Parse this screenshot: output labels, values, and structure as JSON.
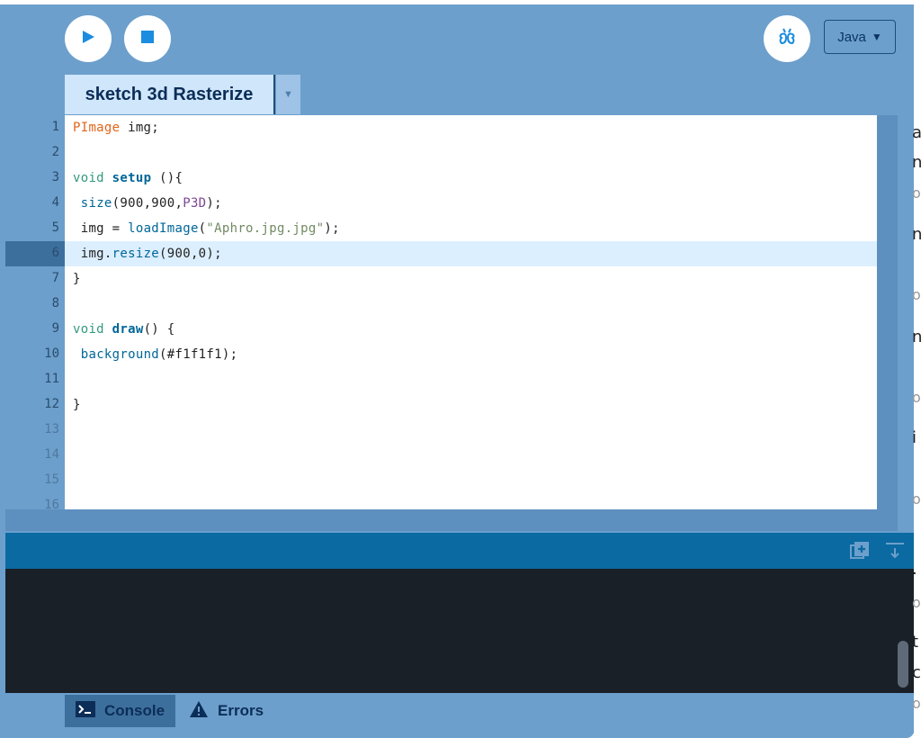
{
  "background_page": {
    "snippets": [
      "a",
      "n",
      "oc",
      "n",
      "oc",
      "n",
      "oc",
      "i",
      "oc",
      ".",
      "oc",
      "t",
      "c",
      "oc"
    ]
  },
  "toolbar": {
    "mode_label": "Java",
    "mode_arrow": "▼"
  },
  "editor": {
    "tab_label": "sketch 3d Rasterize",
    "tab_menu_glyph": "▼",
    "line_numbers": [
      "1",
      "2",
      "3",
      "4",
      "5",
      "6",
      "7",
      "8",
      "9",
      "10",
      "11",
      "12",
      "13",
      "14",
      "15",
      "16"
    ],
    "current_line": 6,
    "lines": [
      [
        {
          "t": "PImage",
          "c": "type"
        },
        {
          "t": " img;",
          "c": "plain"
        }
      ],
      [],
      [
        {
          "t": "void",
          "c": "kw"
        },
        {
          "t": " ",
          "c": "plain"
        },
        {
          "t": "setup",
          "c": "fn"
        },
        {
          "t": " (){",
          "c": "plain"
        }
      ],
      [
        {
          "t": " ",
          "c": "plain"
        },
        {
          "t": "size",
          "c": "builtin"
        },
        {
          "t": "(900,900,",
          "c": "plain"
        },
        {
          "t": "P3D",
          "c": "str"
        },
        {
          "t": ");",
          "c": "plain"
        }
      ],
      [
        {
          "t": " img = ",
          "c": "plain"
        },
        {
          "t": "loadImage",
          "c": "builtin"
        },
        {
          "t": "(",
          "c": "plain"
        },
        {
          "t": "\"Aphro.jpg.jpg\"",
          "c": "const"
        },
        {
          "t": ");",
          "c": "plain"
        }
      ],
      [
        {
          "t": " img.",
          "c": "plain"
        },
        {
          "t": "resize",
          "c": "builtin"
        },
        {
          "t": "(900,0);",
          "c": "plain"
        }
      ],
      [
        {
          "t": "}",
          "c": "plain"
        }
      ],
      [],
      [
        {
          "t": "void",
          "c": "kw"
        },
        {
          "t": " ",
          "c": "plain"
        },
        {
          "t": "draw",
          "c": "fn"
        },
        {
          "t": "() {",
          "c": "plain"
        }
      ],
      [
        {
          "t": " ",
          "c": "plain"
        },
        {
          "t": "background",
          "c": "builtin"
        },
        {
          "t": "(#f1f1f1);",
          "c": "plain"
        }
      ],
      [],
      [
        {
          "t": "}",
          "c": "plain"
        }
      ]
    ]
  },
  "console_tabs": {
    "console_label": "Console",
    "errors_label": "Errors"
  },
  "colors": {
    "window_bg": "#6c9fcc",
    "accent_dark": "#0b2d57",
    "console_bar": "#0a6aa1",
    "console_bg": "#1a2028",
    "play_blue": "#1a8de0"
  }
}
